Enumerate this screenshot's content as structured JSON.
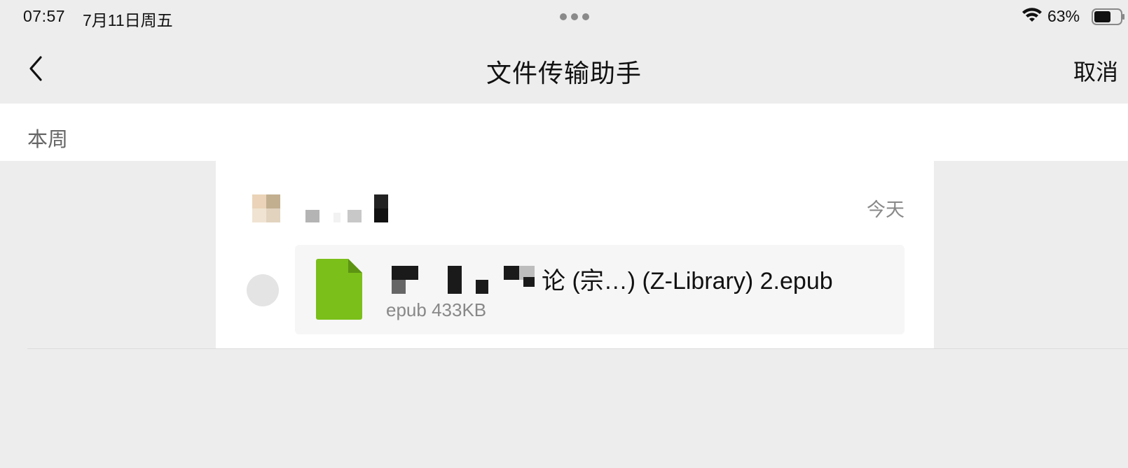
{
  "status_bar": {
    "time": "07:57",
    "date": "7月11日周五",
    "battery_percent": "63%",
    "battery_level": 0.63,
    "wifi_icon": "wifi-icon",
    "battery_icon": "battery-icon"
  },
  "nav": {
    "title": "文件传输助手",
    "cancel_label": "取消",
    "back_icon": "chevron-left-icon"
  },
  "section": {
    "label": "本周"
  },
  "message": {
    "time_label": "今天",
    "file": {
      "name_visible": "论 (宗…) (Z-Library) 2.epub",
      "meta": "epub 433KB",
      "icon": "epub-file-icon",
      "icon_color": "#7bbf1a"
    }
  },
  "colors": {
    "background": "#ededed",
    "card": "#ffffff",
    "bubble": "#f6f6f6",
    "file_icon_green": "#7bbf1a"
  }
}
